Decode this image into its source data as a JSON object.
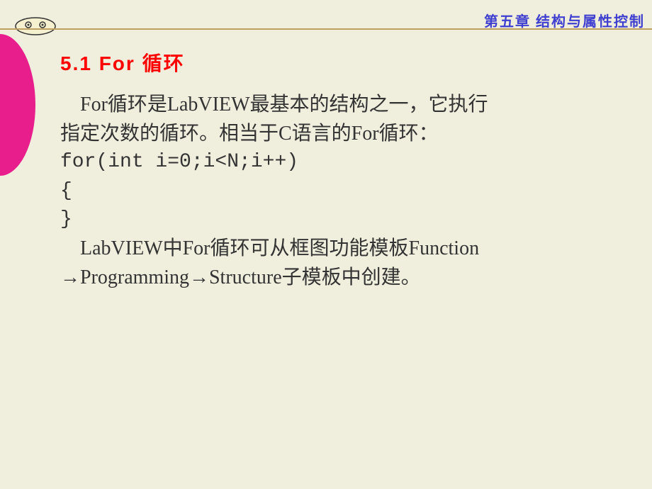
{
  "header": {
    "chapter_title": "第五章  结构与属性控制"
  },
  "section": {
    "title": "5.1 For 循环",
    "para1_line1": "For循环是LabVIEW最基本的结构之一，它执行",
    "para1_line2": "指定次数的循环。相当于C语言的For循环：",
    "code_line1": "for(int i=0;i<N;i++)",
    "code_line2": "{",
    "code_line3": "   }",
    "para2_line1": "LabVIEW中For循环可从框图功能模板Function",
    "para2_line2": "→Programming→Structure子模板中创建。"
  }
}
